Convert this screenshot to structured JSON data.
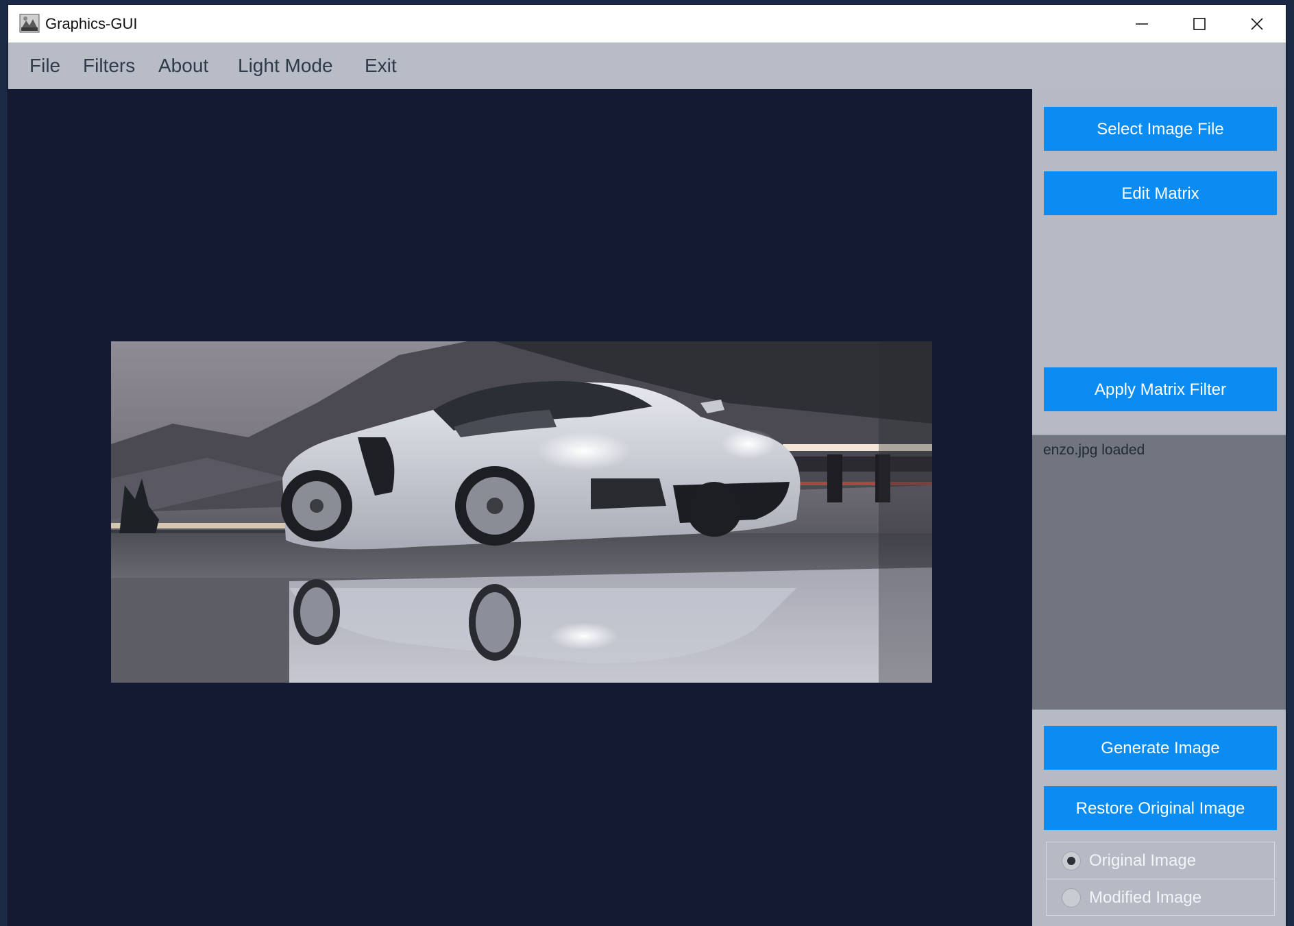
{
  "window": {
    "title": "Graphics-GUI"
  },
  "menu": {
    "items": [
      "File",
      "Filters",
      "About",
      "Light Mode",
      "Exit"
    ]
  },
  "panel": {
    "select_image_label": "Select Image File",
    "edit_matrix_label": "Edit Matrix",
    "apply_filter_label": "Apply Matrix Filter",
    "log_text": "enzo.jpg loaded",
    "generate_label": "Generate Image",
    "restore_label": "Restore Original Image",
    "radio_options": [
      {
        "label": "Original Image",
        "checked": true
      },
      {
        "label": "Modified Image",
        "checked": false
      }
    ]
  },
  "colors": {
    "accent": "#0a8cf2",
    "canvas_bg": "#151a33",
    "panel_bg": "#b6bac4",
    "menubar_bg": "#b8bcc6",
    "log_bg": "#70757f"
  },
  "icons": {
    "app": "app-logo-icon",
    "minimize": "minimize-icon",
    "maximize": "maximize-icon",
    "close": "close-icon"
  }
}
